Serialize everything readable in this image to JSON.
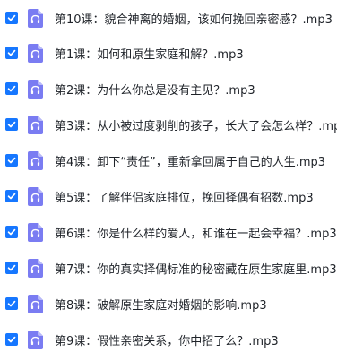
{
  "accent_color": "#1677ff",
  "file_icon": {
    "name": "audio-file-icon",
    "color": "#7a7cf2",
    "glyph": "headphones"
  },
  "files": [
    {
      "checked": true,
      "name": "第10课：貌合神离的婚姻，该如何挽回亲密感？.mp3"
    },
    {
      "checked": true,
      "name": "第1课：如何和原生家庭和解？.mp3"
    },
    {
      "checked": true,
      "name": "第2课：为什么你总是没有主见？.mp3"
    },
    {
      "checked": true,
      "name": "第3课：从小被过度剥削的孩子，长大了会怎么样？.mp3"
    },
    {
      "checked": true,
      "name": "第4课：卸下“责任”，重新拿回属于自己的人生.mp3"
    },
    {
      "checked": true,
      "name": "第5课：了解伴侣家庭排位，挽回择偶有招数.mp3"
    },
    {
      "checked": true,
      "name": "第6课：你是什么样的爱人，和谁在一起会幸福？.mp3"
    },
    {
      "checked": true,
      "name": "第7课：你的真实择偶标准的秘密藏在原生家庭里.mp3"
    },
    {
      "checked": true,
      "name": "第8课：破解原生家庭对婚姻的影响.mp3"
    },
    {
      "checked": true,
      "name": "第9课：假性亲密关系，你中招了么？.mp3"
    }
  ]
}
